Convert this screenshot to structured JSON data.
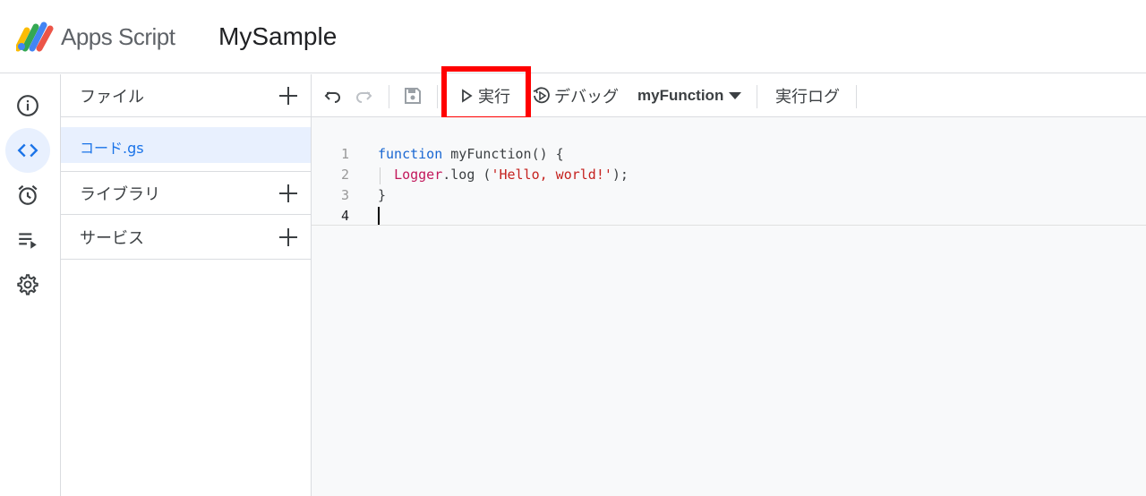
{
  "header": {
    "app_name": "Apps Script",
    "project_name": "MySample"
  },
  "rail": {
    "items": [
      {
        "icon": "info-icon",
        "active": false
      },
      {
        "icon": "code-icon",
        "active": true
      },
      {
        "icon": "alarm-clock-icon",
        "active": false
      },
      {
        "icon": "executions-icon",
        "active": false
      },
      {
        "icon": "gear-icon",
        "active": false
      }
    ]
  },
  "files_panel": {
    "files_label": "ファイル",
    "file_item": "コード.gs",
    "libraries_label": "ライブラリ",
    "services_label": "サービス"
  },
  "toolbar": {
    "run_label": "実行",
    "debug_label": "デバッグ",
    "function_select": "myFunction",
    "execution_log_label": "実行ログ"
  },
  "editor": {
    "line_numbers": [
      "1",
      "2",
      "3",
      "4"
    ],
    "code_lines": [
      "function myFunction() {",
      "  Logger.log ('Hello, world!');",
      "}",
      ""
    ]
  },
  "colors": {
    "accent": "#1a73e8",
    "highlight_box": "#ff0000",
    "keyword": "#1967d2",
    "string": "#c5221f",
    "object": "#c2185b"
  }
}
